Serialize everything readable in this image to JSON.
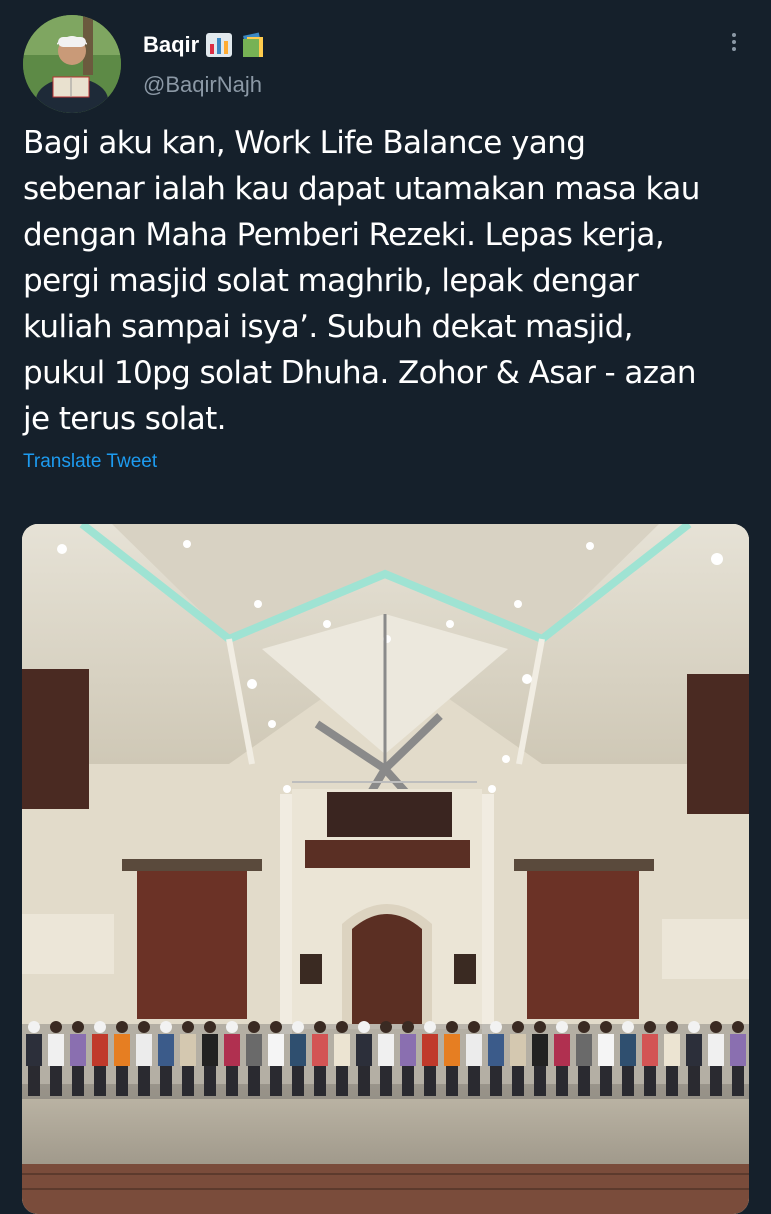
{
  "tweet": {
    "author": {
      "display_name": "Baqir",
      "handle": "@BaqirNajh",
      "emojis": [
        "bar-chart-emoji",
        "books-emoji"
      ]
    },
    "text": "Bagi aku kan, Work Life Balance yang\nsebenar ialah kau dapat utamakan masa kau\ndengan Maha Pemberi Rezeki. Lepas kerja,\npergi masjid solat maghrib, lepak dengar\nkuliah sampai isya’. Subuh dekat masjid,\npukul 10pg solat Dhuha. Zohor & Asar - azan\nje terus solat.",
    "translate_label": "Translate Tweet",
    "media": {
      "description_icon": "mosque-interior-photo"
    }
  },
  "colors": {
    "background": "#15202b",
    "text": "#ffffff",
    "secondary": "#8b98a5",
    "link": "#1d9bf0"
  }
}
